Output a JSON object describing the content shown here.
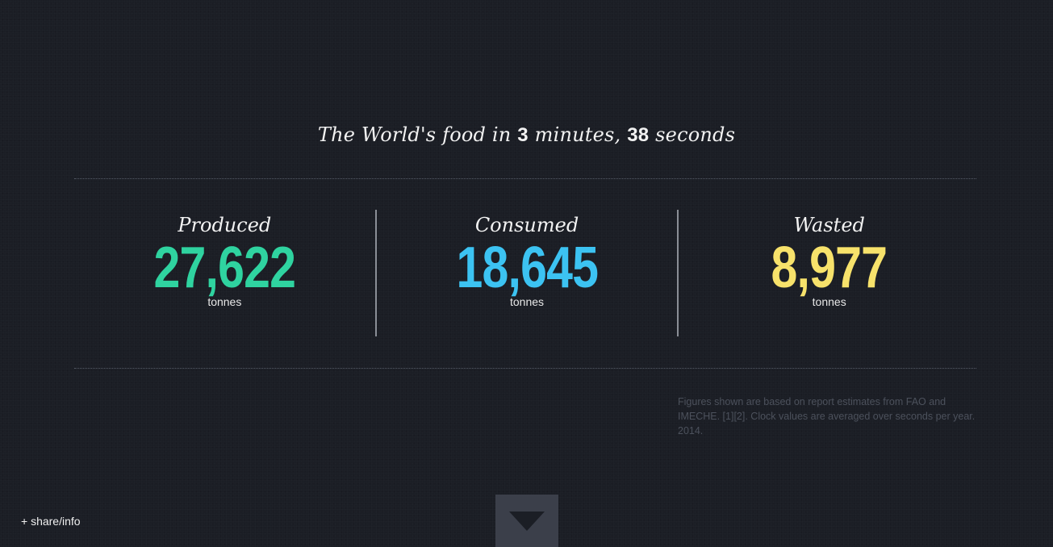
{
  "headline": {
    "prefix": "The World's food in ",
    "minutes": "3",
    "minutes_word": " minutes, ",
    "seconds": "38",
    "seconds_word": " seconds"
  },
  "stats": [
    {
      "label": "Produced",
      "value": "27,622",
      "unit": "tonnes",
      "color": "#2fd3a0"
    },
    {
      "label": "Consumed",
      "value": "18,645",
      "unit": "tonnes",
      "color": "#3cc3f2"
    },
    {
      "label": "Wasted",
      "value": "8,977",
      "unit": "tonnes",
      "color": "#f7e26b"
    }
  ],
  "footnote": "Figures shown are based on report estimates from FAO and IMECHE. [1][2]. Clock values are averaged over seconds per year. 2014.",
  "share_link": "+ share/info",
  "scroll_button": {
    "icon": "triangle-down-icon"
  }
}
